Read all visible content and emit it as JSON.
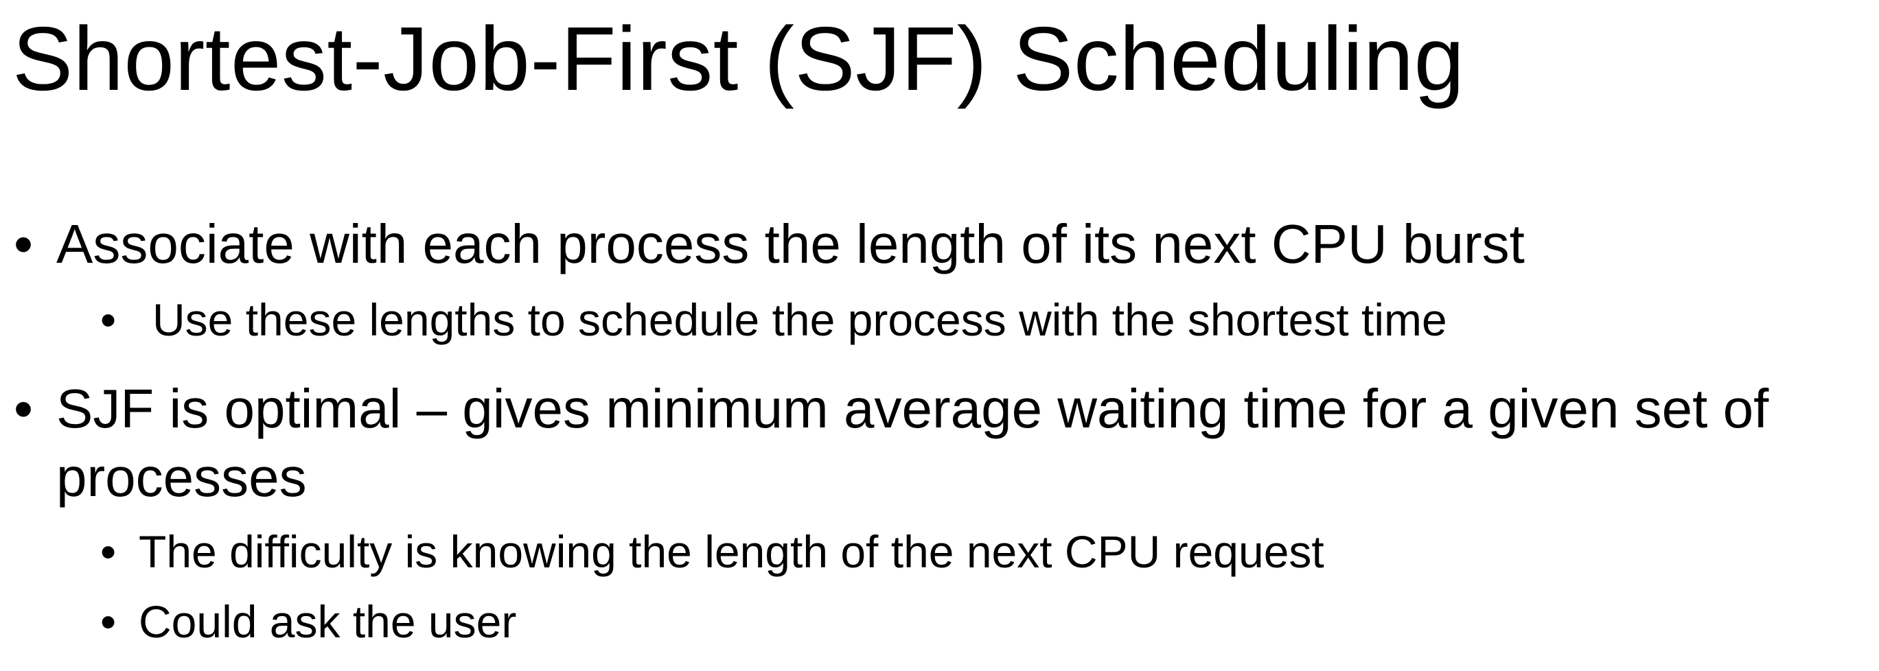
{
  "slide": {
    "title": "Shortest-Job-First (SJF) Scheduling",
    "bullets": [
      {
        "marker": "•",
        "text": "Associate with each process the length of its next CPU burst",
        "sub": [
          {
            "marker": "•",
            "text": "Use these lengths to schedule the process with the shortest time"
          }
        ]
      },
      {
        "marker": "•",
        "text_line1": "SJF is optimal – gives minimum average waiting time for a given set of",
        "text_line2": "processes",
        "sub": [
          {
            "marker": "•",
            "text": "The difficulty is knowing the length of the next CPU request"
          },
          {
            "marker": "•",
            "text": "Could ask the user"
          }
        ]
      }
    ]
  }
}
